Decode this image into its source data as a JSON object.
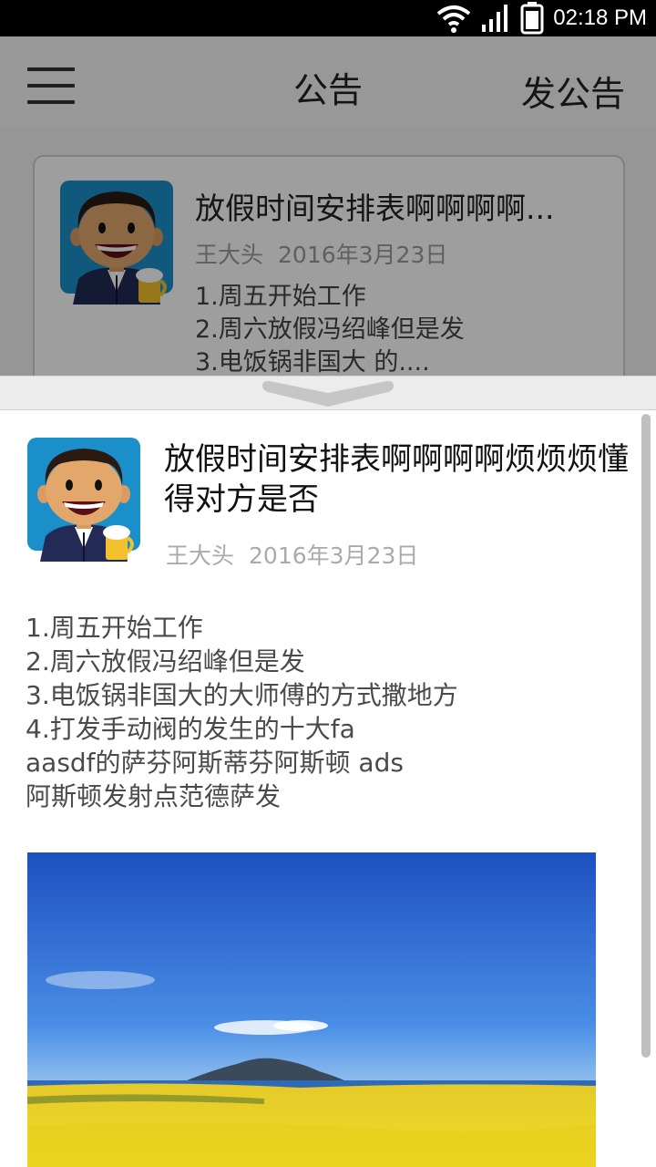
{
  "status_bar": {
    "time": "02:18 PM",
    "icons": [
      "wifi-icon",
      "signal-icon",
      "battery-icon"
    ]
  },
  "header": {
    "menu_icon": "hamburger-menu-icon",
    "title": "公告",
    "action_label": "发公告"
  },
  "announcement_list": [
    {
      "title": "放假时间安排表啊啊啊啊...",
      "author": "王大头",
      "date": "2016年3月23日",
      "preview": [
        "1.周五开始工作",
        "2.周六放假冯绍峰但是发",
        "3.电饭锅非国大 的...."
      ]
    }
  ],
  "detail": {
    "title": "放假时间安排表啊啊啊啊烦烦烦懂得对方是否",
    "author": "王大头",
    "date": "2016年3月23日",
    "body": "1.周五开始工作\n2.周六放假冯绍峰但是发\n3.电饭锅非国大的大师傅的方式撒地方\n4.打发手动阀的发生的十大fa\naasdf的萨芬阿斯蒂芬阿斯顿 ads\n阿斯顿发射点范德萨发",
    "image": "landscape-photo"
  },
  "colors": {
    "status_bar": "#000000",
    "header_bg": "#f5f5f5",
    "avatar_bg": "#1a8fc9",
    "text_dark": "#222222",
    "text_meta": "#999999"
  }
}
